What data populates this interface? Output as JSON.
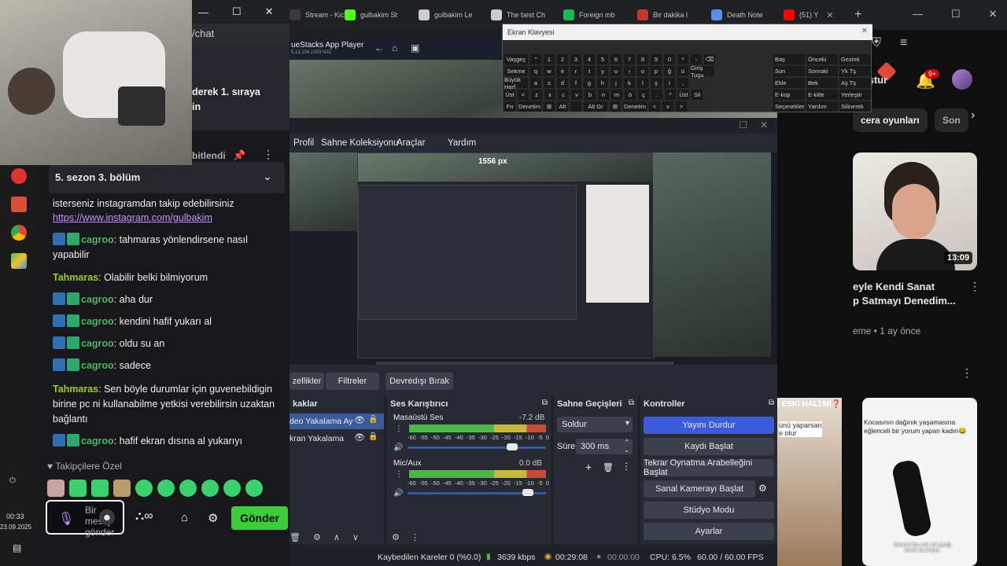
{
  "browser": {
    "tabs": [
      {
        "label": "Stream - Kic",
        "color": "#3a3a3a"
      },
      {
        "label": "gulbakim St",
        "color": "#53fc18"
      },
      {
        "label": "gulbakim Le",
        "color": "#cccccc"
      },
      {
        "label": "The best Ch",
        "color": "#cccccc"
      },
      {
        "label": "Foreign mb",
        "color": "#1db954"
      },
      {
        "label": "Bir dakika l",
        "color": "#c0392b"
      },
      {
        "label": "Death Note",
        "color": "#5b8def"
      },
      {
        "label": "(51) Y",
        "color": "#ff0000"
      }
    ],
    "new_tab": "+",
    "url_partial": "/chat"
  },
  "webcam_window": {
    "minimize": "—",
    "maximize": "☐",
    "close": "✕"
  },
  "youtube": {
    "chips": [
      "cera oyunları",
      "Son"
    ],
    "notif_count": "9+",
    "publish_partial": "ıştur",
    "video1": {
      "duration": "13:09",
      "title": "eyle Kendi Sanat\np Satmayı Denedim...",
      "meta": "eme • 1 ay önce"
    },
    "video2": {
      "title": "İ ESKİ HALİ Mİ❓",
      "caption": "ünü yaparsan\ne olur"
    },
    "video3": {
      "text": "Kocasının dağınık yaşamasına\neğlenceli bir yorum yapan kadın😂",
      "overlay": "Demek bu sen eli ayağı\nkesik bu böyle."
    }
  },
  "chat": {
    "pinned_partial": "derek 1. sıraya\nin",
    "pinned_label": "bitlendi",
    "pinned_title": "5. sezon 3. bölüm",
    "messages": [
      {
        "user": "",
        "text": "isterseniz instagramdan takip edebilirsiniz"
      },
      {
        "user": "",
        "link": "https://www.instagram.com/gulbakim"
      },
      {
        "user": "cagroo",
        "text": ": tahmaras yönlendirsene nasıl yapabilir"
      },
      {
        "user": "Tahmaras",
        "text": ": Olabilir belki bilmiyorum"
      },
      {
        "user": "cagroo",
        "text": ": aha dur"
      },
      {
        "user": "cagroo",
        "text": ": kendini hafif yukarı al"
      },
      {
        "user": "cagroo",
        "text": ": oldu su an"
      },
      {
        "user": "cagroo",
        "text": ": sadece"
      },
      {
        "user": "Tahmaras",
        "text": ": Sen böyle durumlar için guvenebildigin birine pc ni kullanabilme yetkisi verebilirsin uzaktan bağlantı"
      },
      {
        "user": "cagroo",
        "text": ": hafif ekran dısına al yukarıyı"
      }
    ],
    "followers_only": "Takipçilere Özel",
    "input_placeholder": "Bir mesaj gönder",
    "send_button": "Gönder"
  },
  "bluestacks": {
    "title": "ueStacks App Player",
    "version": "5.13.104.1003 N32"
  },
  "obs": {
    "menu": [
      "Profil",
      "Sahne Koleksiyonu",
      "Araçlar",
      "Yardım"
    ],
    "preview_label": "1556 px",
    "buttons_row": [
      "zellikler",
      "Filtreler",
      "Devredışı Bırak"
    ],
    "sources_header": "kaklar",
    "sources": [
      "deo Yakalama Ay",
      "kran Yakalama"
    ],
    "mixer_header": "Ses Karıştırıcı",
    "mixer": [
      {
        "name": "Masaüstü Ses",
        "db": "-7.2 dB"
      },
      {
        "name": "Mic/Aux",
        "db": "0.0 dB"
      }
    ],
    "scale": [
      "-60",
      "-55",
      "-50",
      "-45",
      "-40",
      "-35",
      "-30",
      "-25",
      "-20",
      "-15",
      "-10",
      "-5",
      "0"
    ],
    "transitions_header": "Sahne Geçişleri",
    "transition": "Soldur",
    "duration_label": "Süre",
    "duration_value": "300 ms",
    "controls_header": "Kontroller",
    "controls": [
      "Yayını Durdur",
      "Kaydı Başlat",
      "Tekrar Oynatma Arabelleğini Başlat",
      "Sanal Kamerayı Başlat",
      "Stüdyo Modu",
      "Ayarlar"
    ],
    "status": {
      "dropped": "Kaybedilen Kareler 0 (%0.0)",
      "bitrate": "3639 kbps",
      "stream_time": "00:29:08",
      "rec_time": "00:00:00",
      "cpu": "CPU: 6.5%",
      "fps": "60.00 / 60.00 FPS"
    }
  },
  "osk": {
    "title": "Ekran Klavyesi",
    "rows": [
      [
        "Vaşgeç",
        "\"",
        "1",
        "2",
        "3",
        "4",
        "5",
        "6",
        "7",
        "8",
        "9",
        "0",
        "*",
        "-",
        "⌫"
      ],
      [
        "Sekme",
        "q",
        "w",
        "e",
        "r",
        "t",
        "y",
        "u",
        "ı",
        "o",
        "p",
        "ğ",
        "ü",
        "Giriş Tuşu"
      ],
      [
        "Büyük Harf",
        "a",
        "s",
        "d",
        "f",
        "g",
        "h",
        "j",
        "k",
        "l",
        "ş",
        "i",
        ","
      ],
      [
        "Üst",
        "<",
        "z",
        "x",
        "c",
        "v",
        "b",
        "n",
        "m",
        "ö",
        "ç",
        ".",
        "^",
        "Üst",
        "Sil"
      ],
      [
        "Fn",
        "Denetim",
        "⊞",
        "Alt",
        "",
        "Alt Gr",
        "⊞",
        "Denetim",
        "<",
        "v",
        ">"
      ]
    ],
    "side_keys": [
      "Baş",
      "Önceki",
      "Gezinti",
      "Son",
      "Sonraki",
      "Yk Tş",
      "Ekle",
      "Bek",
      "Aş Tş",
      "E-kop",
      "E-kitle",
      "Yerleştir",
      "Seçenekler",
      "Yardım",
      "Silinerek"
    ]
  },
  "taskbar": {
    "time": "00:33",
    "date": "23.09.2025"
  }
}
